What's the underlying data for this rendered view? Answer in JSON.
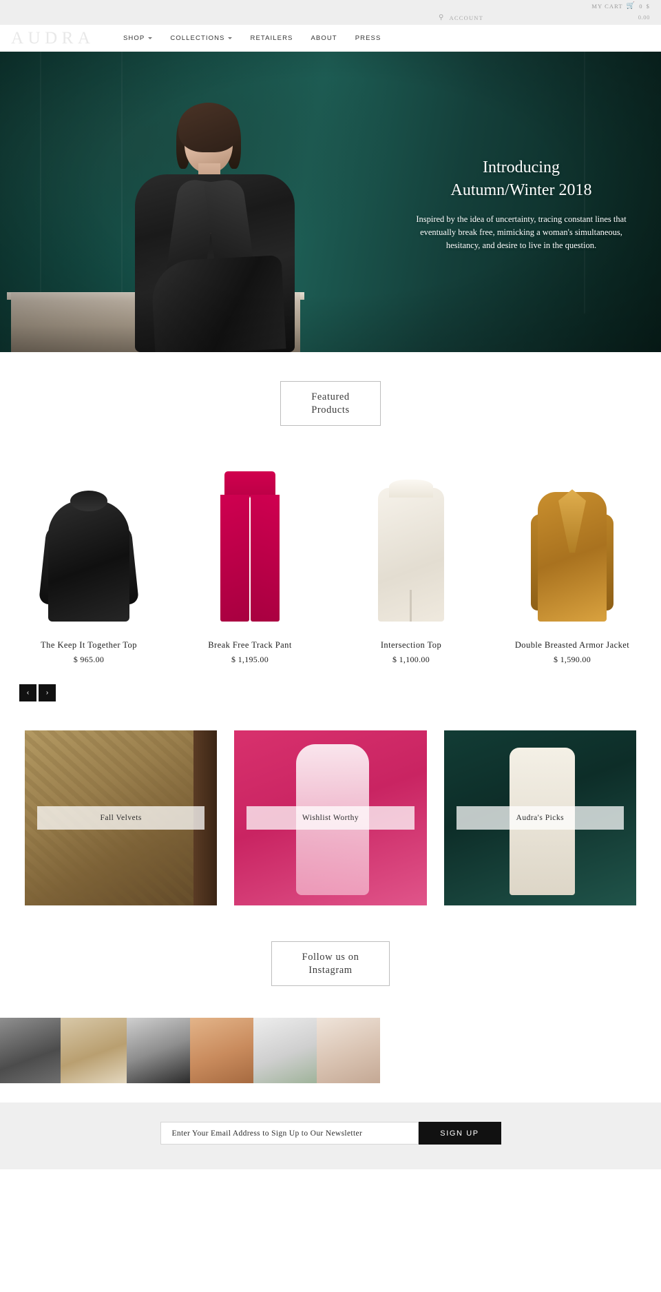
{
  "utility_bar": {
    "cart_label": "MY CART",
    "cart_icon": "shopping-cart-icon",
    "cart_count": "0",
    "cart_currency": "$",
    "search_icon": "search-icon",
    "account_label": "ACCOUNT",
    "cart_total": "0.00"
  },
  "header": {
    "logo": "AUDRA",
    "nav": [
      {
        "label": "SHOP",
        "has_caret": true
      },
      {
        "label": "COLLECTIONS",
        "has_caret": true
      },
      {
        "label": "RETAILERS",
        "has_caret": false
      },
      {
        "label": "ABOUT",
        "has_caret": false
      },
      {
        "label": "PRESS",
        "has_caret": false
      }
    ]
  },
  "hero": {
    "title_line1": "Introducing",
    "title_line2": "Autumn/Winter 2018",
    "body": "Inspired by the idea of uncertainty, tracing constant lines that eventually break free, mimicking a woman's simultaneous, hesitancy, and desire to live in the question."
  },
  "featured": {
    "heading_line1": "Featured",
    "heading_line2": "Products",
    "products": [
      {
        "title": "The Keep It Together Top",
        "price": "$ 965.00"
      },
      {
        "title": "Break Free Track Pant",
        "price": "$ 1,195.00"
      },
      {
        "title": "Intersection Top",
        "price": "$ 1,100.00"
      },
      {
        "title": "Double Breasted Armor Jacket",
        "price": "$ 1,590.00"
      }
    ],
    "prev_label": "‹",
    "next_label": "›"
  },
  "collections": {
    "tiles": [
      {
        "label": "Fall Velvets"
      },
      {
        "label": "Wishlist Worthy"
      },
      {
        "label": "Audra's Picks"
      }
    ]
  },
  "instagram": {
    "heading_line1": "Follow us on",
    "heading_line2": "Instagram"
  },
  "newsletter": {
    "placeholder": "Enter Your Email Address to Sign Up to Our Newsletter",
    "value": "",
    "button_label": "SIGN UP"
  },
  "colors": {
    "bar_bg": "#eeeeee",
    "accent_dark": "#111111",
    "hero_green": "#16524a",
    "logo_gray": "#e8e8e8"
  }
}
